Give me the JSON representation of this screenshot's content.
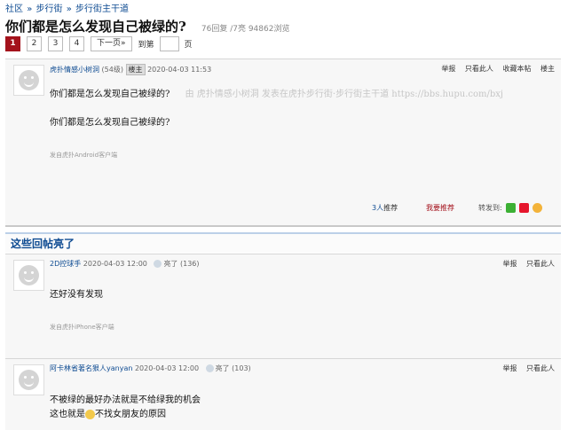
{
  "breadcrumb": [
    "社区",
    "步行街",
    "步行街主干道"
  ],
  "breadcrumb_sep": "»",
  "thread": {
    "title": "你们都是怎么发现自己被绿的?",
    "meta": "76回复 /7亮 94862浏览"
  },
  "pager": {
    "pages": [
      "1",
      "2",
      "3",
      "4"
    ],
    "next": "下一页»",
    "goto_label": "到第",
    "page_unit": "页",
    "active": "1"
  },
  "op": {
    "user": "虎扑情感小树洞",
    "level": "(54级)",
    "badge": "楼主",
    "time": "2020-04-03 11:53",
    "actions": [
      "举报",
      "只看此人",
      "收藏本帖",
      "楼主"
    ],
    "content_line1": "你们都是怎么发现自己被绿的?",
    "watermark": "由 虎扑情感小树洞 发表在虎扑步行街·步行街主干道 https://bbs.hupu.com/bxj",
    "content_line2": "你们都是怎么发现自己被绿的?",
    "device": "发自虎扑Android客户端",
    "recommend_count": "3人",
    "recommend_label": "推荐",
    "want_recommend": "我要推荐",
    "share_label": "转发到:"
  },
  "section_title": "这些回帖亮了",
  "replies": [
    {
      "user": "2D控球手",
      "time": "2020-04-03 12:00",
      "light": "亮了",
      "light_count": "(136)",
      "actions": [
        "举报",
        "只看此人"
      ],
      "content": "还好没有发现",
      "device": "发自虎扑iPhone客户端"
    },
    {
      "user": "阿卡林省著名狠人yanyan",
      "time": "2020-04-03 12:00",
      "light": "亮了",
      "light_count": "(103)",
      "actions": [
        "举报",
        "只看此人"
      ],
      "content_line1": "不被绿的最好办法就是不给绿我的机会",
      "content_line2_a": "这也就是",
      "content_line2_b": "不找女朋友的原因"
    }
  ],
  "colors": {
    "link": "#0e4b92",
    "accent": "#a4121c",
    "section_border": "#bcd0e8"
  }
}
